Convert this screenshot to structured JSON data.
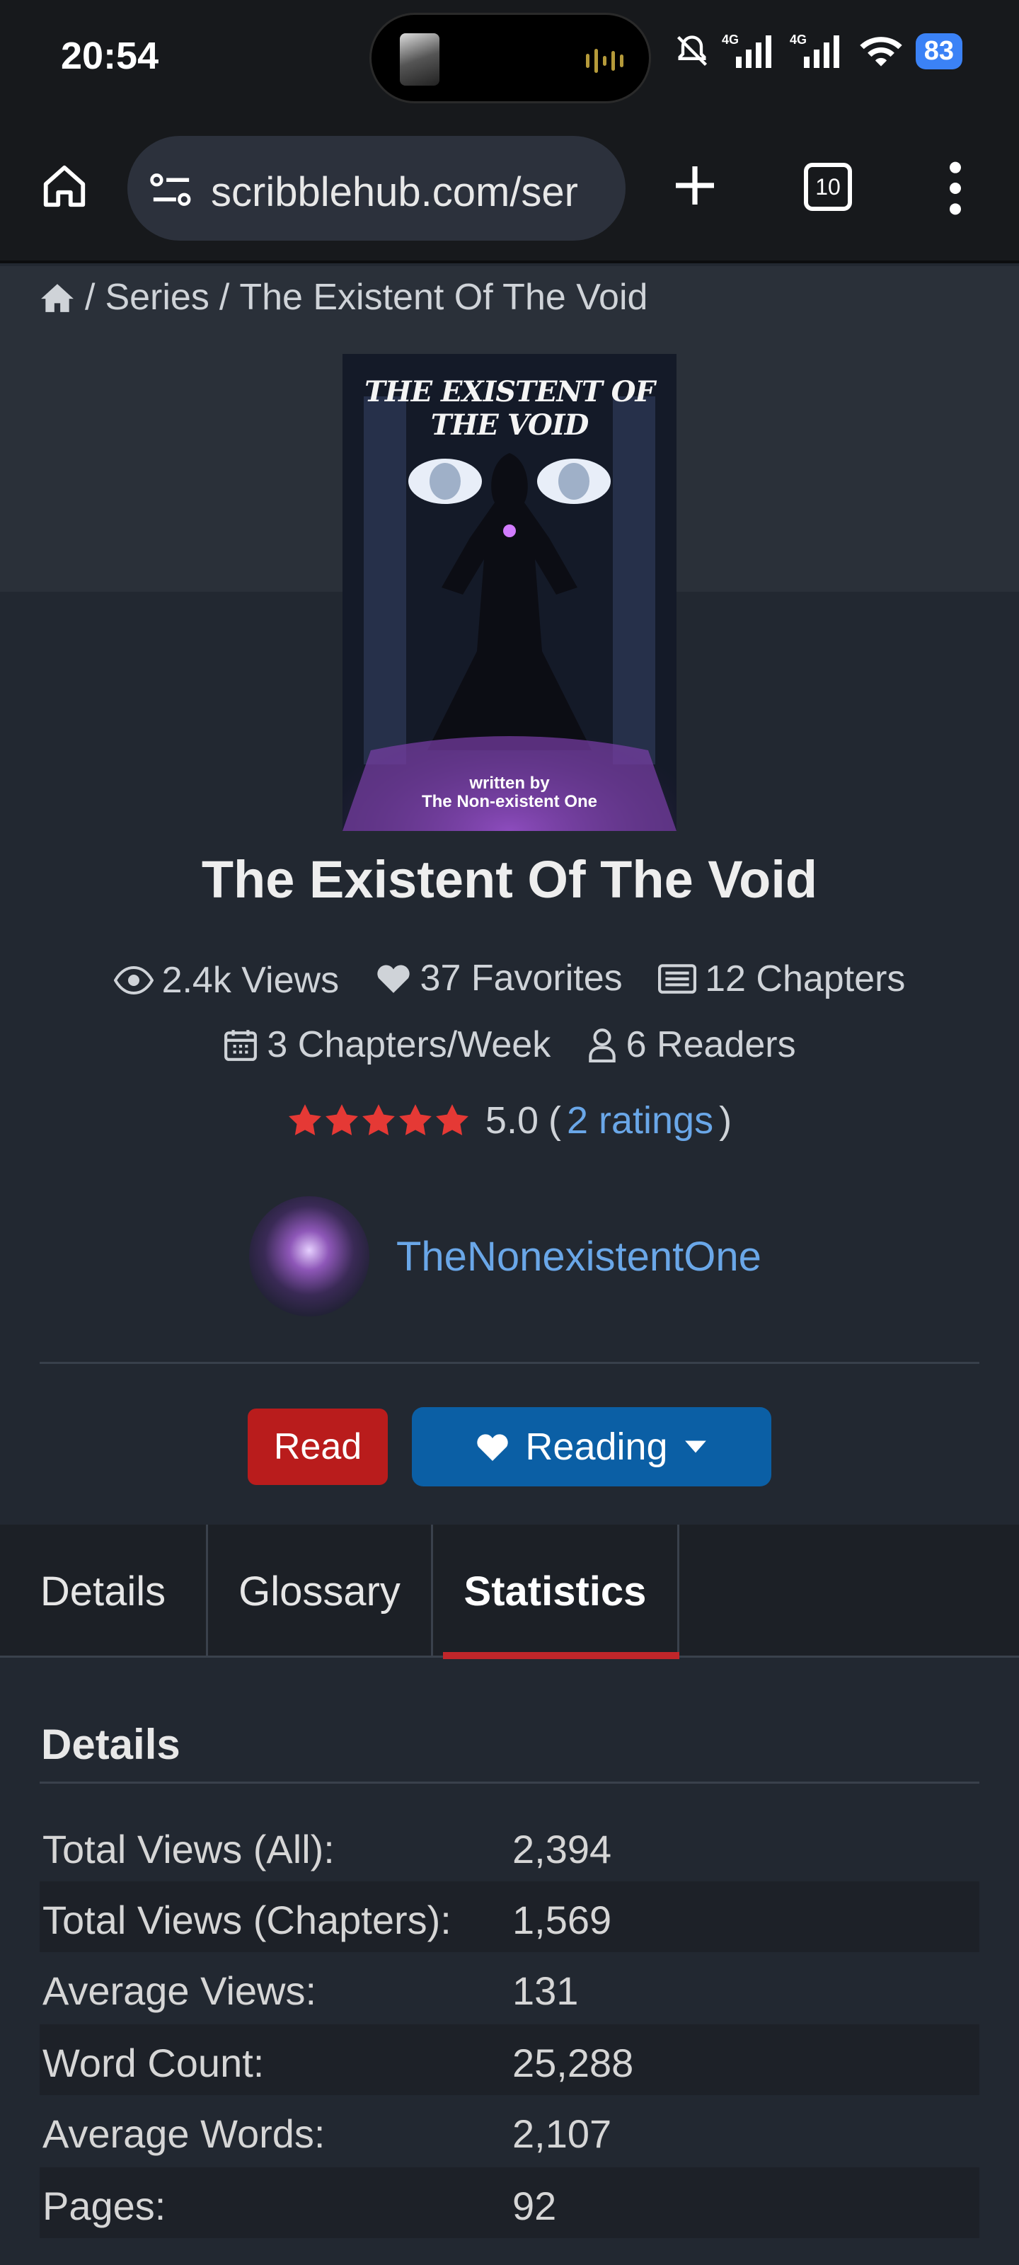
{
  "status_bar": {
    "time": "20:54",
    "signal_1": "4G",
    "signal_2": "4G",
    "battery": "83"
  },
  "browser": {
    "url": "scribblehub.com/ser",
    "tab_count": "10"
  },
  "breadcrumb": {
    "sep1": "/",
    "series": "Series",
    "sep2": "/",
    "current": "The Existent Of The Void"
  },
  "cover": {
    "title": "THE EXISTENT OF THE VOID",
    "byline_1": "written by",
    "byline_2": "The Non-existent One"
  },
  "series": {
    "title": "The Existent Of The Void",
    "views": "2.4k Views",
    "favorites": "37 Favorites",
    "chapters": "12 Chapters",
    "chapters_per_week": "3 Chapters/Week",
    "readers": "6 Readers",
    "rating_value": "5.0",
    "rating_open": "(",
    "ratings_link": "2 ratings",
    "rating_close": ")",
    "stars": 5
  },
  "author": {
    "name": "TheNonexistentOne"
  },
  "actions": {
    "read_label": "Read",
    "reading_label": "Reading"
  },
  "tabs": [
    {
      "label": "Details"
    },
    {
      "label": "Glossary"
    },
    {
      "label": "Statistics"
    }
  ],
  "statistics": {
    "heading": "Details",
    "rows": [
      {
        "label": "Total Views (All):",
        "value": "2,394"
      },
      {
        "label": "Total Views (Chapters):",
        "value": "1,569"
      },
      {
        "label": "Average Views:",
        "value": "131"
      },
      {
        "label": "Word Count:",
        "value": "25,288"
      },
      {
        "label": "Average Words:",
        "value": "2,107"
      },
      {
        "label": "Pages:",
        "value": "92"
      }
    ]
  },
  "colors": {
    "accent_red": "#b91c1c",
    "accent_blue": "#0b5fa5",
    "link": "#6aa7e8",
    "star": "#e53935"
  }
}
